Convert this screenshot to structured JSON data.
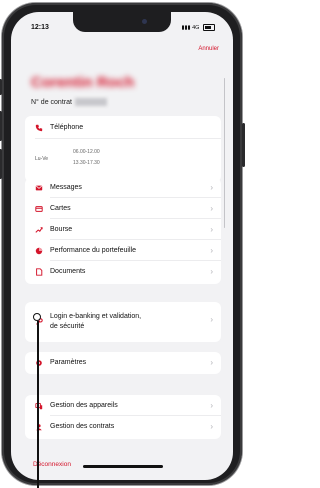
{
  "status": {
    "time": "12:13",
    "network": "4G"
  },
  "header": {
    "cancel_label": "Annuler",
    "name": "Corentin Roch",
    "contract_label": "N° de contrat"
  },
  "contact": {
    "phone_label": "Téléphone",
    "days": "Lu-Ve",
    "hours_morning": "06.00-12.00",
    "hours_afternoon": "13.30-17.30"
  },
  "menu_main": [
    {
      "label": "Messages"
    },
    {
      "label": "Cartes"
    },
    {
      "label": "Bourse"
    },
    {
      "label": "Performance du portefeuille"
    },
    {
      "label": "Documents"
    }
  ],
  "security": {
    "label_line1": "Login e-banking et validation,",
    "label_line2": "de sécurité"
  },
  "settings": {
    "label": "Paramètres"
  },
  "menu_manage": [
    {
      "label": "Gestion des appareils"
    },
    {
      "label": "Gestion des contrats"
    }
  ],
  "logout_label": "Déconnexion",
  "colors": {
    "accent": "#d4152b",
    "background": "#f2f2f4",
    "card": "#ffffff"
  }
}
